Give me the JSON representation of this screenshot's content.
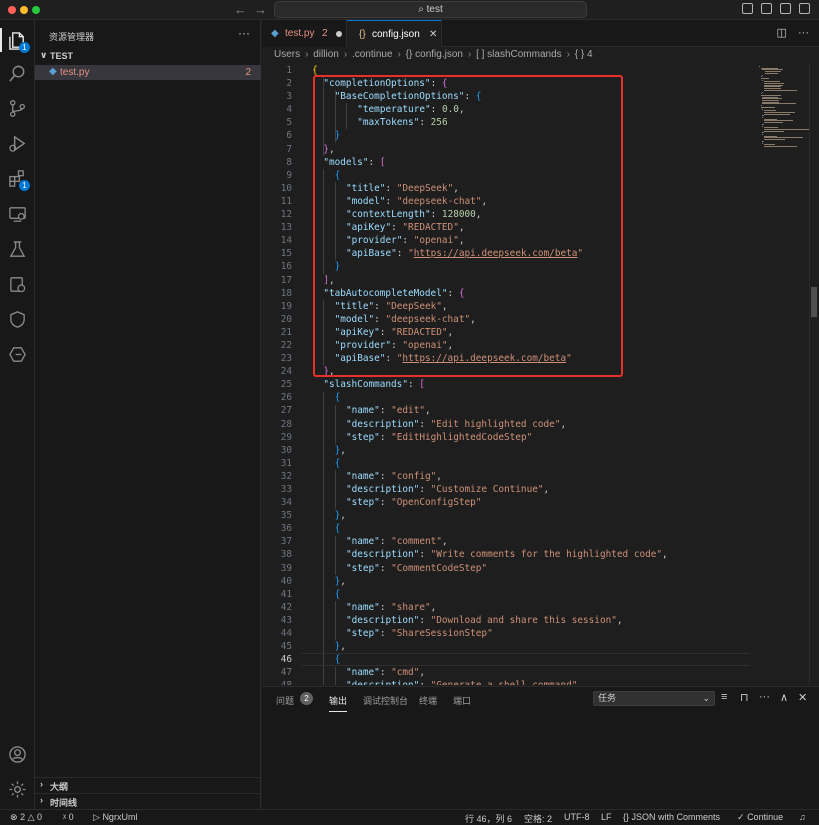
{
  "titlebar": {
    "search_text": "test"
  },
  "sidebar": {
    "title": "资源管理器",
    "folder": "TEST",
    "files": [
      {
        "name": "test.py",
        "problems": "2"
      }
    ],
    "sections": [
      {
        "label": "大纲"
      },
      {
        "label": "时间线"
      }
    ]
  },
  "activity": {
    "explorer_badge": "1",
    "extensions_badge": "1"
  },
  "tabs": [
    {
      "label": "test.py",
      "problems": "2",
      "modified": true
    },
    {
      "label": "config.json",
      "active": true
    }
  ],
  "breadcrumb": [
    "Users",
    "dillion",
    ".continue",
    "{} config.json",
    "[ ] slashCommands",
    "{ } 4"
  ],
  "editor": {
    "language": "JSON with Comments",
    "current_line": 46,
    "lines": [
      {
        "n": 1,
        "t": "{"
      },
      {
        "n": 2,
        "t": "  \"completionOptions\": {"
      },
      {
        "n": 3,
        "t": "    \"BaseCompletionOptions\": {"
      },
      {
        "n": 4,
        "t": "        \"temperature\": 0.0,"
      },
      {
        "n": 5,
        "t": "        \"maxTokens\": 256"
      },
      {
        "n": 6,
        "t": "    }"
      },
      {
        "n": 7,
        "t": "  },"
      },
      {
        "n": 8,
        "t": "  \"models\": ["
      },
      {
        "n": 9,
        "t": "    {"
      },
      {
        "n": 10,
        "t": "      \"title\": \"DeepSeek\","
      },
      {
        "n": 11,
        "t": "      \"model\": \"deepseek-chat\","
      },
      {
        "n": 12,
        "t": "      \"contextLength\": 128000,"
      },
      {
        "n": 13,
        "t": "      \"apiKey\": \"REDACTED\","
      },
      {
        "n": 14,
        "t": "      \"provider\": \"openai\","
      },
      {
        "n": 15,
        "t": "      \"apiBase\": \"https://api.deepseek.com/beta\""
      },
      {
        "n": 16,
        "t": "    }"
      },
      {
        "n": 17,
        "t": "  ],"
      },
      {
        "n": 18,
        "t": "  \"tabAutocompleteModel\": {"
      },
      {
        "n": 19,
        "t": "    \"title\": \"DeepSeek\","
      },
      {
        "n": 20,
        "t": "    \"model\": \"deepseek-chat\","
      },
      {
        "n": 21,
        "t": "    \"apiKey\": \"REDACTED\","
      },
      {
        "n": 22,
        "t": "    \"provider\": \"openai\","
      },
      {
        "n": 23,
        "t": "    \"apiBase\": \"https://api.deepseek.com/beta\""
      },
      {
        "n": 24,
        "t": "  },"
      },
      {
        "n": 25,
        "t": "  \"slashCommands\": ["
      },
      {
        "n": 26,
        "t": "    {"
      },
      {
        "n": 27,
        "t": "      \"name\": \"edit\","
      },
      {
        "n": 28,
        "t": "      \"description\": \"Edit highlighted code\","
      },
      {
        "n": 29,
        "t": "      \"step\": \"EditHighlightedCodeStep\""
      },
      {
        "n": 30,
        "t": "    },"
      },
      {
        "n": 31,
        "t": "    {"
      },
      {
        "n": 32,
        "t": "      \"name\": \"config\","
      },
      {
        "n": 33,
        "t": "      \"description\": \"Customize Continue\","
      },
      {
        "n": 34,
        "t": "      \"step\": \"OpenConfigStep\""
      },
      {
        "n": 35,
        "t": "    },"
      },
      {
        "n": 36,
        "t": "    {"
      },
      {
        "n": 37,
        "t": "      \"name\": \"comment\","
      },
      {
        "n": 38,
        "t": "      \"description\": \"Write comments for the highlighted code\","
      },
      {
        "n": 39,
        "t": "      \"step\": \"CommentCodeStep\""
      },
      {
        "n": 40,
        "t": "    },"
      },
      {
        "n": 41,
        "t": "    {"
      },
      {
        "n": 42,
        "t": "      \"name\": \"share\","
      },
      {
        "n": 43,
        "t": "      \"description\": \"Download and share this session\","
      },
      {
        "n": 44,
        "t": "      \"step\": \"ShareSessionStep\""
      },
      {
        "n": 45,
        "t": "    },"
      },
      {
        "n": 46,
        "t": "    {"
      },
      {
        "n": 47,
        "t": "      \"name\": \"cmd\","
      },
      {
        "n": 48,
        "t": "      \"description\": \"Generate a shell command\","
      }
    ]
  },
  "panel": {
    "tabs": [
      {
        "label": "问题",
        "badge": "2"
      },
      {
        "label": "输出",
        "active": true
      },
      {
        "label": "调试控制台"
      },
      {
        "label": "终端"
      },
      {
        "label": "端口"
      }
    ],
    "select_value": "任务"
  },
  "statusbar": {
    "errors": "2",
    "warnings": "0",
    "ports": "0",
    "remote": "NgrxUml",
    "cursor": "行 46，列 6",
    "spaces": "空格: 2",
    "encoding": "UTF-8",
    "eol": "LF",
    "language": "JSON with Comments",
    "continue": "Continue"
  },
  "colors": {
    "accent": "#0078d4",
    "highlight_box": "#e8302a",
    "json_key": "#9cdcfe",
    "json_string": "#ce9178",
    "json_number": "#b5cea8"
  }
}
